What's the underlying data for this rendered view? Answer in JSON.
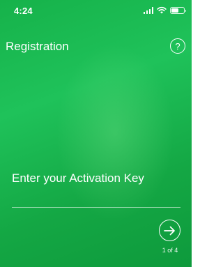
{
  "status_bar": {
    "time": "4:24",
    "battery_level": 0.6
  },
  "header": {
    "title": "Registration",
    "help_symbol": "?"
  },
  "form": {
    "prompt": "Enter your Activation Key",
    "activation_key_value": "",
    "activation_key_placeholder": ""
  },
  "navigation": {
    "step_indicator": "1 of 4"
  },
  "theme": {
    "background": "#1aba52",
    "foreground": "#ffffff"
  },
  "icons": {
    "signal": "cellular-signal-icon",
    "wifi": "wifi-icon",
    "battery": "battery-icon",
    "help": "question-circle-icon",
    "next": "arrow-right-circle-icon"
  }
}
